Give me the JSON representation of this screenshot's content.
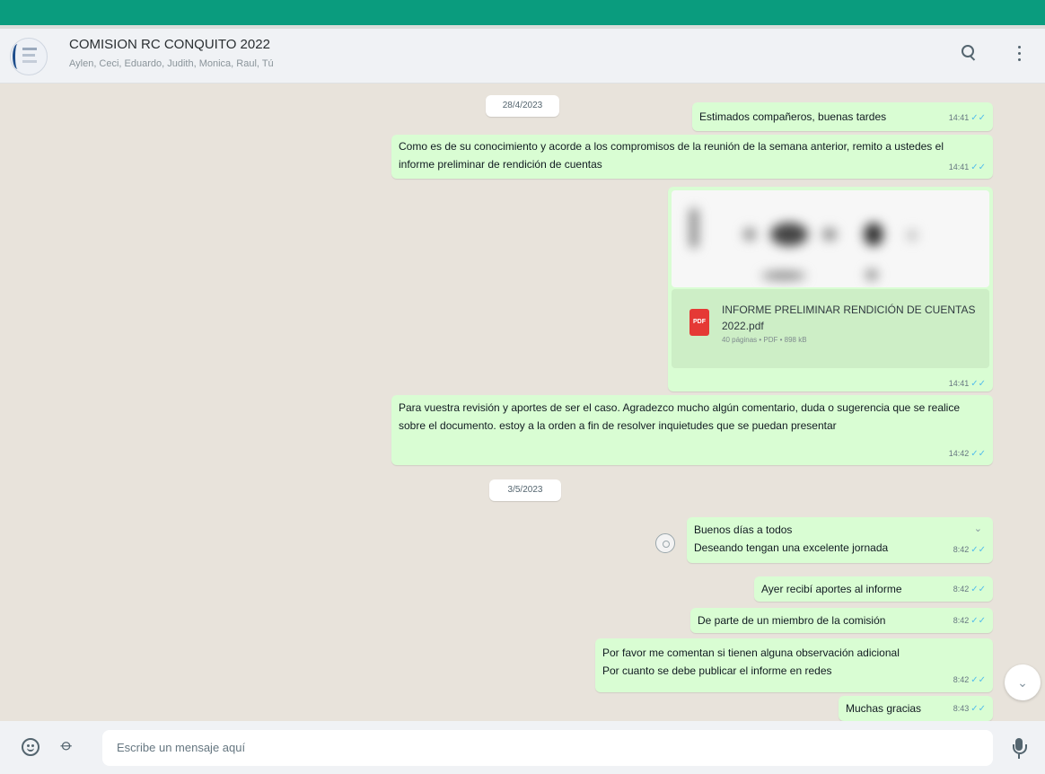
{
  "header": {
    "title": "COMISION RC CONQUITO 2022",
    "subtitle": "Aylen, Ceci, Eduardo, Judith, Monica, Raul, Tú"
  },
  "messages": {
    "date1": "28/4/2023",
    "date2": "3/5/2023",
    "m1": {
      "text": "Estimados compañeros, buenas tardes",
      "time": "14:41"
    },
    "m2": {
      "text": "Como es de su conocimiento y acorde a los compromisos de la reunión de la semana anterior, remito a ustedes el informe preliminar de rendición de cuentas",
      "time": "14:41"
    },
    "doc": {
      "icon_label": "PDF",
      "file_name": "INFORME PRELIMINAR RENDICIÓN DE CUENTAS 2022.pdf",
      "file_meta": "40 páginas • PDF • 898 kB",
      "time": "14:41"
    },
    "m3": {
      "text": "Para vuestra revisión y aportes de ser el caso. Agradezco mucho algún comentario, duda o sugerencia que se realice sobre el documento. estoy a la orden a fin de resolver inquietudes que se puedan presentar",
      "time": "14:42"
    },
    "m4": {
      "line1": "Buenos días a todos",
      "line2": "Deseando tengan una excelente jornada",
      "time": "8:42"
    },
    "m5": {
      "text": "Ayer recibí aportes al informe",
      "time": "8:42"
    },
    "m6": {
      "text": "De parte de un miembro de la comisión",
      "time": "8:42"
    },
    "m7": {
      "line1": "Por favor me comentan si tienen alguna observación adicional",
      "line2": "Por cuanto se debe publicar el informe en redes",
      "time": "8:42"
    },
    "m8": {
      "text": "Muchas gracias",
      "time": "8:43"
    }
  },
  "footer": {
    "placeholder": "Escribe un mensaje aquí"
  },
  "colors": {
    "accent": "#0a9c7e",
    "outgoing_bubble": "#d9fdd3",
    "tick": "#53bdeb"
  }
}
